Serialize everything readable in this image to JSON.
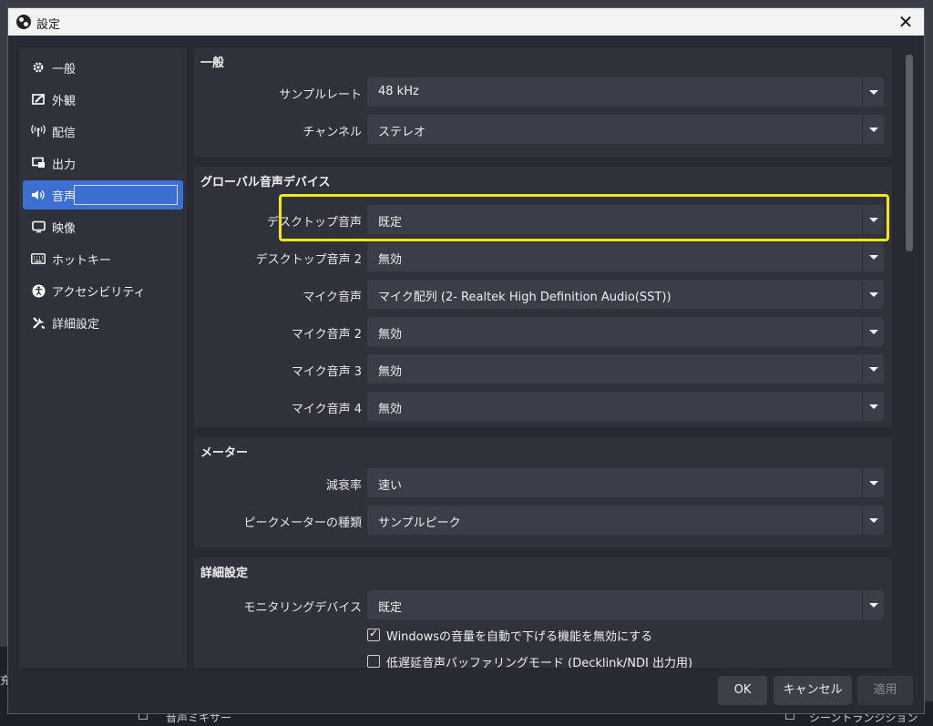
{
  "window": {
    "title": "設定"
  },
  "sidebar": {
    "items": [
      {
        "label": "一般",
        "icon": "gear-icon"
      },
      {
        "label": "外観",
        "icon": "appearance-icon"
      },
      {
        "label": "配信",
        "icon": "broadcast-icon"
      },
      {
        "label": "出力",
        "icon": "output-icon"
      },
      {
        "label": "音声",
        "icon": "speaker-icon",
        "active": true
      },
      {
        "label": "映像",
        "icon": "monitor-icon"
      },
      {
        "label": "ホットキー",
        "icon": "keyboard-icon"
      },
      {
        "label": "アクセシビリティ",
        "icon": "accessibility-icon"
      },
      {
        "label": "詳細設定",
        "icon": "tools-icon"
      }
    ]
  },
  "sections": {
    "general": {
      "title": "一般",
      "sample_rate_label": "サンプルレート",
      "sample_rate_value": "48 kHz",
      "channels_label": "チャンネル",
      "channels_value": "ステレオ"
    },
    "global_devices": {
      "title": "グローバル音声デバイス",
      "rows": [
        {
          "label": "デスクトップ音声",
          "value": "既定"
        },
        {
          "label": "デスクトップ音声 2",
          "value": "無効"
        },
        {
          "label": "マイク音声",
          "value": "マイク配列 (2- Realtek High Definition Audio(SST))"
        },
        {
          "label": "マイク音声 2",
          "value": "無効"
        },
        {
          "label": "マイク音声 3",
          "value": "無効"
        },
        {
          "label": "マイク音声 4",
          "value": "無効"
        }
      ]
    },
    "meters": {
      "title": "メーター",
      "decay_label": "減衰率",
      "decay_value": "速い",
      "peak_type_label": "ピークメーターの種類",
      "peak_type_value": "サンプルピーク"
    },
    "advanced": {
      "title": "詳細設定",
      "monitoring_label": "モニタリングデバイス",
      "monitoring_value": "既定",
      "ducking_label": "Windowsの音量を自動で下げる機能を無効にする",
      "ducking_checked": true,
      "low_latency_label": "低遅延音声バッファリングモード (Decklink/NDI 出力用)",
      "low_latency_checked": false
    }
  },
  "buttons": {
    "ok": "OK",
    "cancel": "キャンセル",
    "apply": "適用"
  },
  "background": {
    "mixer_label": "音声ミキサー",
    "transition_label": "シーントランジション",
    "left_edge_text": "充"
  },
  "colors": {
    "accent": "#3c6fd1",
    "highlight": "#f5e61b"
  }
}
